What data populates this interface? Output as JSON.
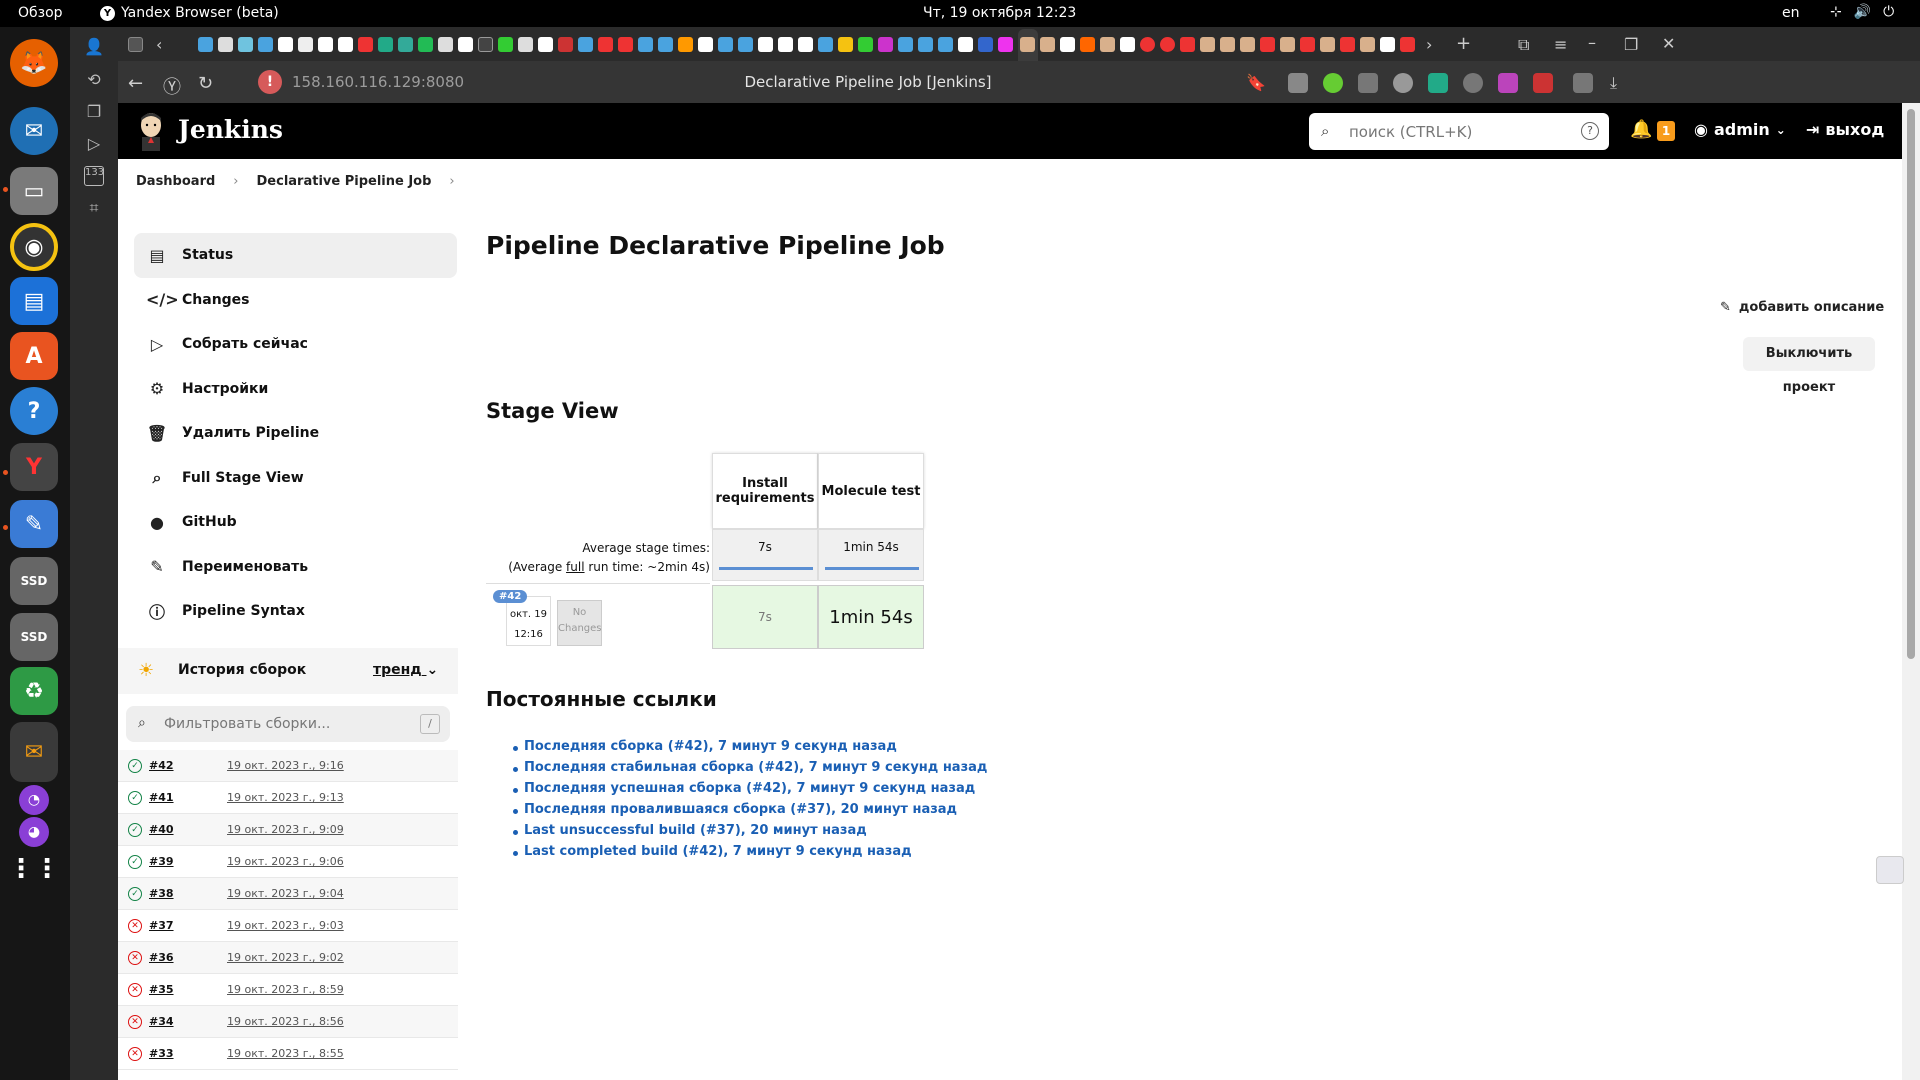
{
  "topbar": {
    "overview": "Обзор",
    "app_name": "Yandex Browser (beta)",
    "clock": "Чт, 19 октября  12:23",
    "lang": "en"
  },
  "browser": {
    "url": "158.160.116.129:8080",
    "title": "Declarative Pipeline Job [Jenkins]"
  },
  "jenkins": {
    "brand": "Jenkins",
    "search_placeholder": "поиск (CTRL+K)",
    "notifications": "1",
    "user": "admin",
    "logout": "выход"
  },
  "breadcrumb": {
    "items": [
      "Dashboard",
      "Declarative Pipeline Job"
    ]
  },
  "tasks": [
    {
      "label": "Status",
      "icon": "status-icon"
    },
    {
      "label": "Changes",
      "icon": "code-icon"
    },
    {
      "label": "Собрать сейчас",
      "icon": "play-icon"
    },
    {
      "label": "Настройки",
      "icon": "gear-icon"
    },
    {
      "label": "Удалить Pipeline",
      "icon": "trash-icon"
    },
    {
      "label": "Full Stage View",
      "icon": "search-icon"
    },
    {
      "label": "GitHub",
      "icon": "github-icon"
    },
    {
      "label": "Переименовать",
      "icon": "pencil-icon"
    },
    {
      "label": "Pipeline Syntax",
      "icon": "help-icon"
    }
  ],
  "history": {
    "title": "История сборок",
    "trend": "тренд",
    "filter_placeholder": "Фильтровать сборки...",
    "filter_shortcut": "/",
    "builds": [
      {
        "num": "#42",
        "date": "19 окт. 2023 г., 9:16",
        "status": "success"
      },
      {
        "num": "#41",
        "date": "19 окт. 2023 г., 9:13",
        "status": "success"
      },
      {
        "num": "#40",
        "date": "19 окт. 2023 г., 9:09",
        "status": "success"
      },
      {
        "num": "#39",
        "date": "19 окт. 2023 г., 9:06",
        "status": "success"
      },
      {
        "num": "#38",
        "date": "19 окт. 2023 г., 9:04",
        "status": "success"
      },
      {
        "num": "#37",
        "date": "19 окт. 2023 г., 9:03",
        "status": "failed"
      },
      {
        "num": "#36",
        "date": "19 окт. 2023 г., 9:02",
        "status": "failed"
      },
      {
        "num": "#35",
        "date": "19 окт. 2023 г., 8:59",
        "status": "failed"
      },
      {
        "num": "#34",
        "date": "19 окт. 2023 г., 8:56",
        "status": "failed"
      },
      {
        "num": "#33",
        "date": "19 окт. 2023 г., 8:55",
        "status": "failed"
      }
    ]
  },
  "main": {
    "title": "Pipeline Declarative Pipeline Job",
    "add_description": "добавить описание",
    "disable_project": "Выключить проект",
    "stage_view_title": "Stage View"
  },
  "stage_view": {
    "avg_label": "Average stage times:",
    "avg_full_prefix": "(Average ",
    "avg_full_word": "full",
    "avg_full_suffix": " run time: ~2min 4s)",
    "stages": [
      {
        "name": "Install requirements",
        "avg": "7s",
        "avg_fraction": 1.0,
        "run": "7s"
      },
      {
        "name": "Molecule test",
        "avg": "1min 54s",
        "avg_fraction": 1.0,
        "run": "1min 54s"
      }
    ],
    "run": {
      "tag": "#42",
      "date": "окт. 19",
      "time": "12:16",
      "changes": "No Changes"
    }
  },
  "permalinks": {
    "title": "Постоянные ссылки",
    "items": [
      "Последняя сборка (#42), 7 минут 9 секунд назад",
      "Последняя стабильная сборка (#42), 7 минут 9 секунд назад",
      "Последняя успешная сборка (#42), 7 минут 9 секунд назад",
      "Последняя провалившаяся сборка (#37), 20 минут назад",
      "Last unsuccessful build (#37), 20 минут назад",
      "Last completed build (#42), 7 минут 9 секунд назад"
    ]
  },
  "colors": {
    "success": "#138347",
    "failed": "#dd1111",
    "link": "#1a5fb4",
    "stage_success": "#e6f8e2",
    "accent_bar": "#5b8fd3"
  }
}
